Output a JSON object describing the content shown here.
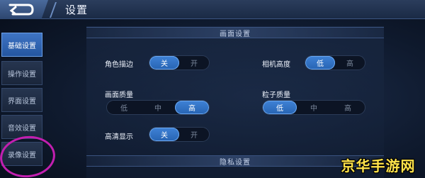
{
  "header": {
    "title": "设置"
  },
  "sidebar": {
    "tabs": [
      {
        "label": "基础设置",
        "active": true
      },
      {
        "label": "操作设置",
        "active": false
      },
      {
        "label": "界面设置",
        "active": false
      },
      {
        "label": "音效设置",
        "active": false
      },
      {
        "label": "录像设置",
        "active": false
      }
    ],
    "highlight_color": "#c21fb0"
  },
  "sections": {
    "display": {
      "title": "画面设置"
    },
    "privacy": {
      "title": "隐私设置"
    }
  },
  "settings": {
    "outline": {
      "label": "角色描边",
      "options": [
        "关",
        "开"
      ],
      "selected": "关"
    },
    "camera_height": {
      "label": "相机高度",
      "options": [
        "低",
        "高"
      ],
      "selected": "低"
    },
    "graphics_quality": {
      "label": "画面质量",
      "options": [
        "低",
        "中",
        "高"
      ],
      "selected": "高"
    },
    "particle_quality": {
      "label": "粒子质量",
      "options": [
        "低",
        "中",
        "高"
      ],
      "selected": "低"
    },
    "hd_display": {
      "label": "高清显示",
      "options": [
        "关",
        "开"
      ],
      "selected": "关"
    }
  },
  "watermark": {
    "text": "京华手游网"
  },
  "colors": {
    "accent": "#3f82d6",
    "highlight_circle": "#c21fb0",
    "watermark": "#ffe34a"
  }
}
